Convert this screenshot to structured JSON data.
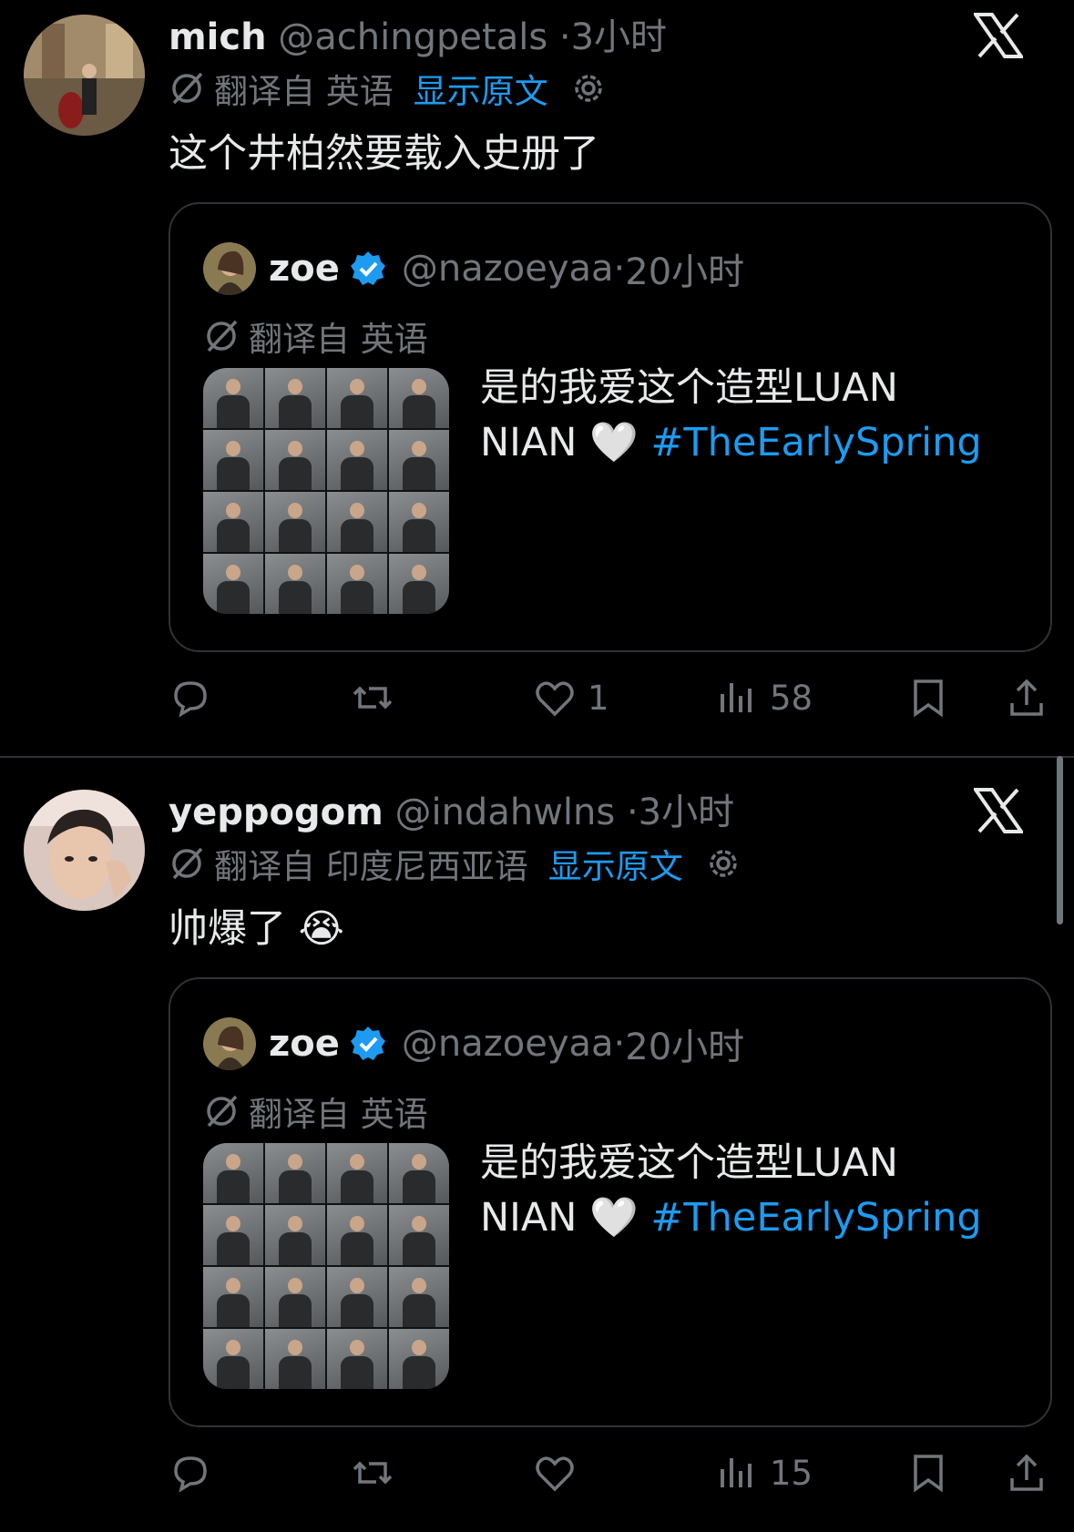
{
  "tweets": [
    {
      "name": "mich",
      "handle": "@achingpetals",
      "sep": "·",
      "time": "3小时",
      "translate_label": "翻译自 英语",
      "show_original": "显示原文",
      "text": "这个井柏然要载入史册了",
      "quote": {
        "name": "zoe",
        "handle": "@nazoeyaa",
        "sep": "·",
        "time": "20小时",
        "translate_label": "翻译自 英语",
        "text_line1": "是的我爱这个造型LUAN",
        "text_line2": "NIAN 🤍",
        "hashtag": "#TheEarlySpring"
      },
      "actions": {
        "reply": "",
        "retweet": "",
        "like": "1",
        "views": "58"
      }
    },
    {
      "name": "yeppogom",
      "handle": "@indahwlns",
      "sep": "·",
      "time": "3小时",
      "translate_label": "翻译自 印度尼西亚语",
      "show_original": "显示原文",
      "text": "帅爆了 😭",
      "quote": {
        "name": "zoe",
        "handle": "@nazoeyaa",
        "sep": "·",
        "time": "20小时",
        "translate_label": "翻译自 英语",
        "text_line1": "是的我爱这个造型LUAN",
        "text_line2": "NIAN 🤍",
        "hashtag": "#TheEarlySpring"
      },
      "actions": {
        "reply": "",
        "retweet": "",
        "like": "",
        "views": "15"
      }
    }
  ],
  "colors": {
    "accent": "#1d9bf0",
    "muted": "#71767b",
    "border": "#2f3336",
    "background": "#000000"
  },
  "icons": [
    "x-logo-icon",
    "translate-icon",
    "gear-icon",
    "verified-icon",
    "reply-icon",
    "retweet-icon",
    "like-icon",
    "views-icon",
    "bookmark-icon",
    "share-icon"
  ]
}
